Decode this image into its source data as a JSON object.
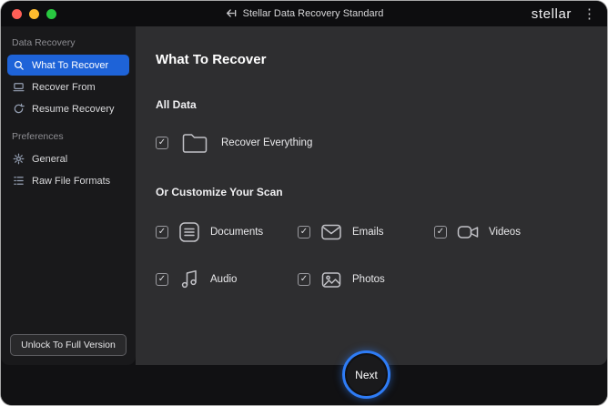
{
  "titlebar": {
    "title": "Stellar Data Recovery Standard",
    "brand": "stellar"
  },
  "icons": {
    "menu": "⋮",
    "check": "✓"
  },
  "sidebar": {
    "sections": [
      {
        "header": "Data Recovery",
        "items": [
          {
            "label": "What To Recover",
            "selected": true
          },
          {
            "label": "Recover From",
            "selected": false
          },
          {
            "label": "Resume Recovery",
            "selected": false
          }
        ]
      },
      {
        "header": "Preferences",
        "items": [
          {
            "label": "General",
            "selected": false
          },
          {
            "label": "Raw File Formats",
            "selected": false
          }
        ]
      }
    ],
    "unlock_button": "Unlock To Full Version"
  },
  "main": {
    "title": "What To Recover",
    "sections": {
      "all_data": "All Data",
      "customize": "Or Customize Your Scan"
    },
    "recover_everything": {
      "label": "Recover Everything",
      "checked": true
    },
    "options": [
      {
        "label": "Documents",
        "checked": true
      },
      {
        "label": "Emails",
        "checked": true
      },
      {
        "label": "Videos",
        "checked": true
      },
      {
        "label": "Audio",
        "checked": true
      },
      {
        "label": "Photos",
        "checked": true
      }
    ],
    "next_button": "Next"
  },
  "colors": {
    "accent_blue": "#2e7cf6",
    "selected_item": "#1e63d8",
    "traffic_red": "#ff5f57",
    "traffic_yellow": "#febc2e",
    "traffic_green": "#28c840"
  }
}
